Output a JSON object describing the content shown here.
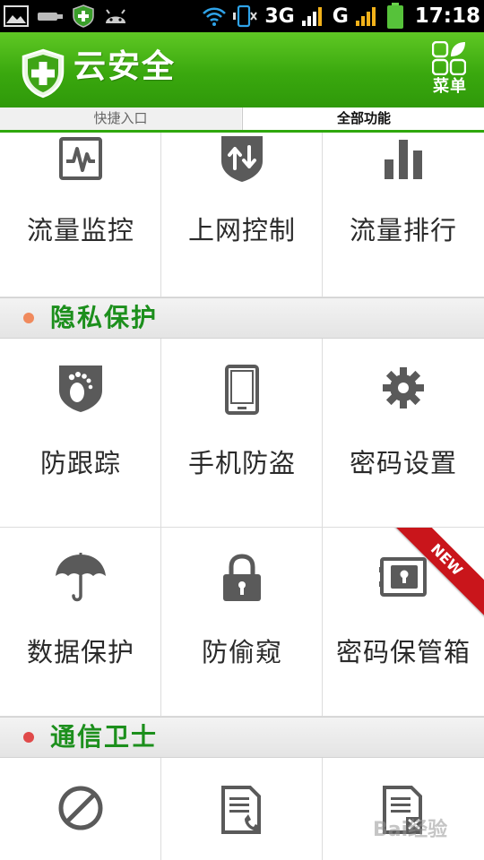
{
  "status_bar": {
    "network_3g": "3G",
    "network_g": "G",
    "time": "17:18"
  },
  "header": {
    "title": "云安全",
    "menu_label": "菜单"
  },
  "tabs": {
    "quick": "快捷入口",
    "all": "全部功能"
  },
  "traffic": {
    "items": [
      {
        "label": "流量监控",
        "icon": "traffic-monitor-icon"
      },
      {
        "label": "上网控制",
        "icon": "network-control-icon"
      },
      {
        "label": "流量排行",
        "icon": "traffic-ranking-icon"
      }
    ]
  },
  "privacy": {
    "title": "隐私保护",
    "dot_color": "#f08a5d",
    "items": [
      {
        "label": "防跟踪",
        "icon": "anti-tracking-icon"
      },
      {
        "label": "手机防盗",
        "icon": "anti-theft-phone-icon"
      },
      {
        "label": "密码设置",
        "icon": "gear-icon"
      },
      {
        "label": "数据保护",
        "icon": "umbrella-icon"
      },
      {
        "label": "防偷窥",
        "icon": "lock-icon"
      },
      {
        "label": "密码保管箱",
        "icon": "safe-icon",
        "badge": "NEW"
      }
    ]
  },
  "comm": {
    "title": "通信卫士",
    "dot_color": "#e04a4a",
    "items": [
      {
        "label": "",
        "icon": "block-icon"
      },
      {
        "label": "",
        "icon": "call-log-icon"
      },
      {
        "label": "",
        "icon": "message-block-icon"
      }
    ]
  },
  "watermark": "Bai经验",
  "colors": {
    "accent_green": "#2fa80c",
    "icon_gray": "#5a5a5a",
    "section_title_green": "#1c8f1c",
    "new_ribbon": "#c9151b"
  }
}
